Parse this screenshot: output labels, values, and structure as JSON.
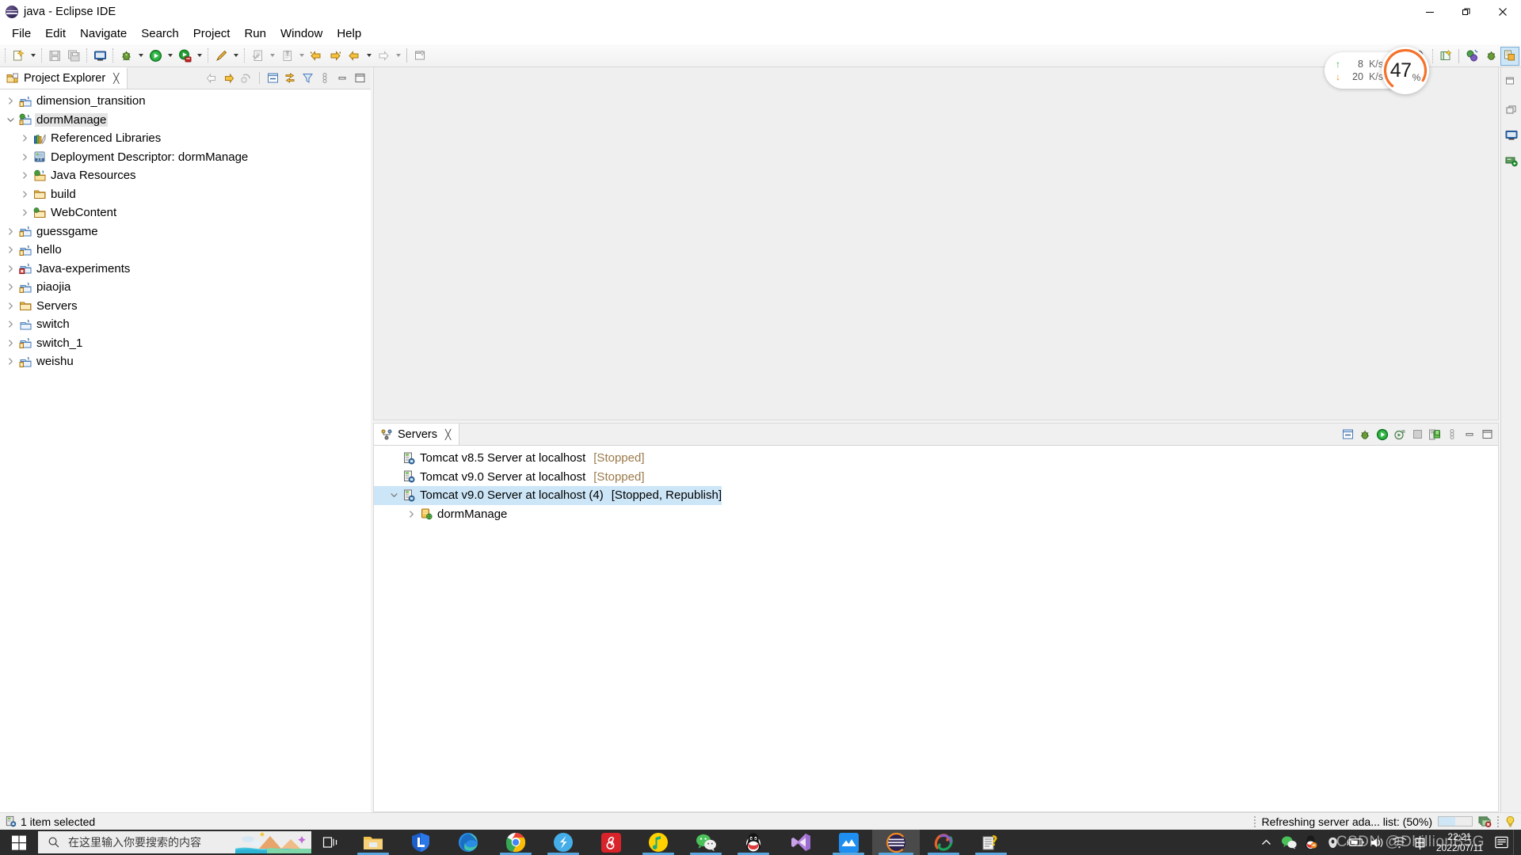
{
  "window": {
    "title": "java - Eclipse IDE",
    "app_icon": "eclipse-icon",
    "minimize": "—",
    "maximize": "❐",
    "close": "✕"
  },
  "menubar": {
    "items": [
      {
        "label": "File"
      },
      {
        "label": "Edit"
      },
      {
        "label": "Navigate"
      },
      {
        "label": "Search"
      },
      {
        "label": "Project"
      },
      {
        "label": "Run"
      },
      {
        "label": "Window"
      },
      {
        "label": "Help"
      }
    ]
  },
  "toolbar": {
    "buttons": [
      {
        "name": "new-wizard",
        "dropdown": true
      },
      {
        "name": "save",
        "dropdown": false
      },
      {
        "name": "save-all",
        "dropdown": false
      },
      {
        "name": "console",
        "dropdown": false
      },
      {
        "name": "debug",
        "dropdown": true
      },
      {
        "name": "run",
        "dropdown": true
      },
      {
        "name": "run-on-server",
        "dropdown": true
      },
      {
        "name": "external-tools",
        "dropdown": true
      },
      {
        "name": "next-annotation",
        "dropdown": true
      },
      {
        "name": "previous-annotation",
        "dropdown": true
      },
      {
        "name": "back",
        "dropdown": false
      },
      {
        "name": "forward-history",
        "dropdown": false
      },
      {
        "name": "back-history",
        "dropdown": true
      },
      {
        "name": "forward",
        "dropdown": true
      },
      {
        "name": "new-editor",
        "dropdown": false
      }
    ],
    "right_buttons": [
      {
        "name": "search"
      },
      {
        "name": "open-perspective"
      },
      {
        "name": "perspective-java-ee"
      },
      {
        "name": "perspective-debug"
      },
      {
        "name": "perspective-java-active"
      }
    ]
  },
  "explorer": {
    "tab_label": "Project Explorer",
    "tab_icon": "project-explorer-icon",
    "close_glyph": "╳",
    "toolbar": [
      {
        "name": "back-arrow-icon"
      },
      {
        "name": "forward-arrow-icon"
      },
      {
        "name": "up-arrow-icon"
      },
      {
        "name": "collapse-all-icon"
      },
      {
        "name": "link-with-editor-icon"
      },
      {
        "name": "view-filter-icon"
      },
      {
        "name": "view-menu-icon"
      },
      {
        "name": "minimize-icon"
      },
      {
        "name": "maximize-icon"
      }
    ],
    "tree": [
      {
        "label": "dimension_transition",
        "icon": "java-project-icon",
        "depth": 0,
        "twisty": "collapsed",
        "selected": "none"
      },
      {
        "label": "dormManage",
        "icon": "dynamic-web-project-icon",
        "depth": 0,
        "twisty": "expanded",
        "selected": "grey"
      },
      {
        "label": "Referenced Libraries",
        "icon": "referenced-libraries-icon",
        "depth": 1,
        "twisty": "collapsed",
        "selected": "none"
      },
      {
        "label": "Deployment Descriptor: dormManage",
        "icon": "deployment-descriptor-icon",
        "depth": 1,
        "twisty": "collapsed",
        "selected": "none"
      },
      {
        "label": "Java Resources",
        "icon": "java-resources-icon",
        "depth": 1,
        "twisty": "collapsed",
        "selected": "none"
      },
      {
        "label": "build",
        "icon": "folder-icon",
        "depth": 1,
        "twisty": "collapsed",
        "selected": "none"
      },
      {
        "label": "WebContent",
        "icon": "web-folder-icon",
        "depth": 1,
        "twisty": "collapsed",
        "selected": "none"
      },
      {
        "label": "guessgame",
        "icon": "java-project-icon",
        "depth": 0,
        "twisty": "collapsed",
        "selected": "none"
      },
      {
        "label": "hello",
        "icon": "java-project-icon",
        "depth": 0,
        "twisty": "collapsed",
        "selected": "none"
      },
      {
        "label": "Java-experiments",
        "icon": "java-project-error-icon",
        "depth": 0,
        "twisty": "collapsed",
        "selected": "none"
      },
      {
        "label": "piaojia",
        "icon": "java-project-icon",
        "depth": 0,
        "twisty": "collapsed",
        "selected": "none"
      },
      {
        "label": "Servers",
        "icon": "folder-icon",
        "depth": 0,
        "twisty": "collapsed",
        "selected": "none"
      },
      {
        "label": "switch",
        "icon": "project-icon",
        "depth": 0,
        "twisty": "collapsed",
        "selected": "none"
      },
      {
        "label": "switch_1",
        "icon": "java-project-icon",
        "depth": 0,
        "twisty": "collapsed",
        "selected": "none"
      },
      {
        "label": "weishu",
        "icon": "java-project-icon",
        "depth": 0,
        "twisty": "collapsed",
        "selected": "none"
      }
    ]
  },
  "servers_view": {
    "tab_label": "Servers",
    "tab_icon": "servers-icon",
    "close_glyph": "╳",
    "toolbar": [
      {
        "name": "collapse-all-icon"
      },
      {
        "name": "debug-server-icon"
      },
      {
        "name": "start-server-icon"
      },
      {
        "name": "profile-server-icon"
      },
      {
        "name": "stop-server-icon"
      },
      {
        "name": "publish-server-icon"
      },
      {
        "name": "view-menu-icon"
      },
      {
        "name": "minimize-icon"
      },
      {
        "name": "maximize-icon"
      }
    ],
    "rows": [
      {
        "label": "Tomcat v8.5 Server at localhost",
        "status": "[Stopped]",
        "icon": "server-icon",
        "depth": 0,
        "twisty": "none",
        "selected": false
      },
      {
        "label": "Tomcat v9.0 Server at localhost",
        "status": "[Stopped]",
        "icon": "server-icon",
        "depth": 0,
        "twisty": "none",
        "selected": false
      },
      {
        "label": "Tomcat v9.0 Server at localhost (4)",
        "status": "[Stopped, Republish]",
        "icon": "server-icon",
        "depth": 0,
        "twisty": "expanded",
        "selected": true
      },
      {
        "label": "dormManage",
        "status": "",
        "icon": "web-module-icon",
        "depth": 1,
        "twisty": "collapsed",
        "selected": false
      }
    ]
  },
  "statusbar": {
    "left_icon": "server-icon",
    "left_text": "1 item selected",
    "progress_text": "Refreshing server ada... list: (50%)",
    "progress_percent": 50,
    "progress_icon": "progress-stop-icon",
    "tip_icon": "quick-access-tip-icon"
  },
  "perf_widget": {
    "upload_arrow": "↑",
    "upload_value": "8",
    "upload_unit": "K/s",
    "download_arrow": "↓",
    "download_value": "20",
    "download_unit": "K/s",
    "cpu_value": "47",
    "cpu_unit": "%",
    "ring_color": "#f4722b",
    "ring_percent": 72
  },
  "taskbar": {
    "start_icon": "windows-start-icon",
    "search_placeholder": "在这里输入你要搜索的内容",
    "search_icon": "search-icon",
    "task_view_icon": "task-view-icon",
    "apps": [
      {
        "name": "file-explorer-icon",
        "running": true,
        "active": false
      },
      {
        "name": "lenovo-icon",
        "running": false,
        "active": false
      },
      {
        "name": "microsoft-edge-icon",
        "running": false,
        "active": false
      },
      {
        "name": "google-chrome-icon",
        "running": true,
        "active": false
      },
      {
        "name": "sogou-icon",
        "running": true,
        "active": false
      },
      {
        "name": "netease-music-icon",
        "running": false,
        "active": false
      },
      {
        "name": "qq-music-icon",
        "running": false,
        "active": false
      },
      {
        "name": "wechat-icon",
        "running": true,
        "active": false
      },
      {
        "name": "qq-icon",
        "running": true,
        "active": false
      },
      {
        "name": "visual-studio-icon",
        "running": false,
        "active": false
      },
      {
        "name": "mindmaster-icon",
        "running": true,
        "active": false
      },
      {
        "name": "eclipse-icon",
        "running": true,
        "active": true
      },
      {
        "name": "navicat-icon",
        "running": true,
        "active": false
      },
      {
        "name": "unknown-doc-icon",
        "running": true,
        "active": false
      }
    ],
    "tray": [
      {
        "name": "show-hidden-icons-icon"
      },
      {
        "name": "wechat-tray-icon"
      },
      {
        "name": "qq-tray-icon"
      },
      {
        "name": "nvidia-tray-icon"
      },
      {
        "name": "battery-charging-icon"
      },
      {
        "name": "volume-icon"
      },
      {
        "name": "wifi-icon"
      },
      {
        "name": "ime-chinese-icon"
      }
    ],
    "clock_time": "22:21",
    "clock_date": "2022/07/11",
    "action_center_icon": "action-center-icon"
  },
  "watermark": {
    "text": "CSDN @DhillionB5G"
  }
}
